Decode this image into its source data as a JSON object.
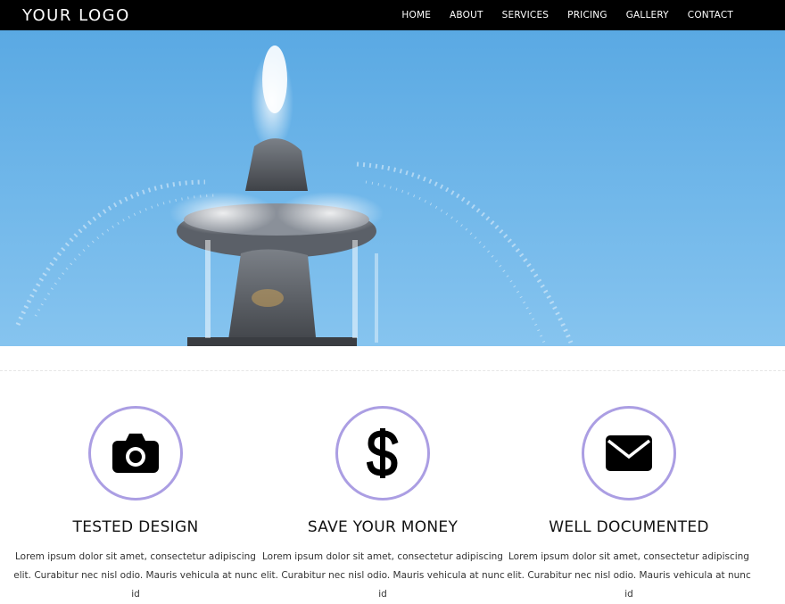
{
  "header": {
    "logo": "YOUR LOGO",
    "nav": [
      "HOME",
      "ABOUT",
      "SERVICES",
      "PRICING",
      "GALLERY",
      "CONTACT"
    ]
  },
  "hero": {
    "image": "fountain-against-blue-sky"
  },
  "features": [
    {
      "icon": "camera-icon",
      "title": "TESTED DESIGN",
      "text": "Lorem ipsum dolor sit amet, consectetur adipiscing elit. Curabitur nec nisl odio. Mauris vehicula at nunc id"
    },
    {
      "icon": "dollar-icon",
      "title": "SAVE YOUR MONEY",
      "text": "Lorem ipsum dolor sit amet, consectetur adipiscing elit. Curabitur nec nisl odio. Mauris vehicula at nunc id"
    },
    {
      "icon": "envelope-icon",
      "title": "WELL DOCUMENTED",
      "text": "Lorem ipsum dolor sit amet, consectetur adipiscing elit. Curabitur nec nisl odio. Mauris vehicula at nunc id"
    }
  ],
  "colors": {
    "topbar": "#000000",
    "circle_border": "#ab9ee3",
    "sky": "#6fb5e8"
  }
}
